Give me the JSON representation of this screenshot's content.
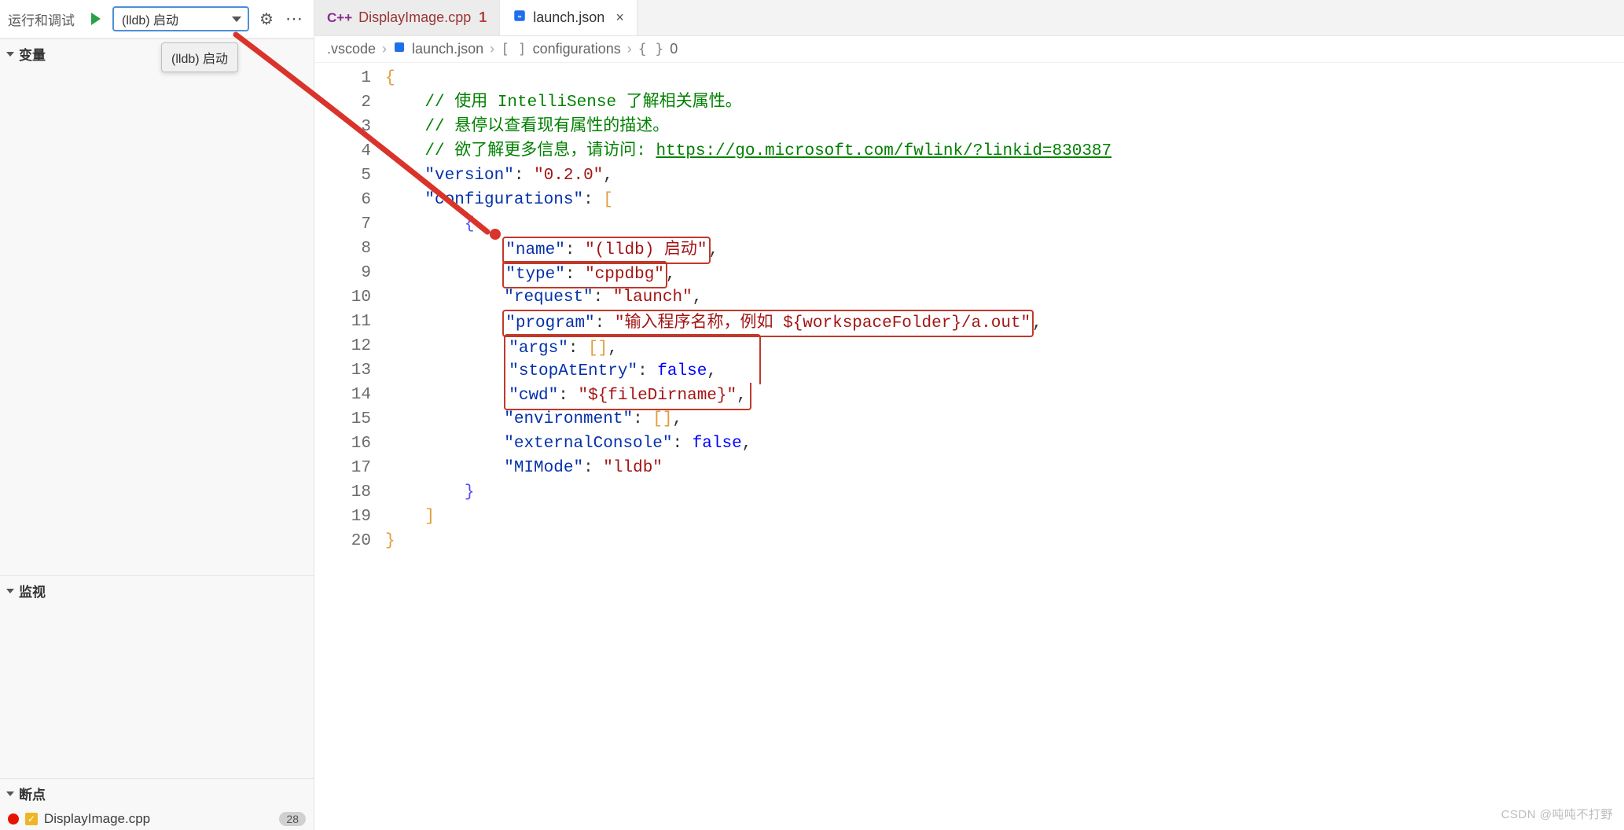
{
  "sidebar": {
    "title": "运行和调试",
    "config_selected": "(lldb) 启动",
    "tooltip": "(lldb) 启动",
    "sections": {
      "variables": "变量",
      "watch": "监视",
      "breakpoints": "断点"
    },
    "breakpoint": {
      "file": "DisplayImage.cpp",
      "count": "28"
    }
  },
  "tabs": [
    {
      "icon": "C++",
      "label": "DisplayImage.cpp",
      "dirty": "1",
      "active": false
    },
    {
      "icon": "⚙",
      "label": "launch.json",
      "close": "×",
      "active": true
    }
  ],
  "breadcrumbs": {
    "folder": ".vscode",
    "file": "launch.json",
    "path1": "configurations",
    "path2": "0"
  },
  "gutter": [
    "1",
    "2",
    "3",
    "4",
    "5",
    "6",
    "7",
    "8",
    "9",
    "10",
    "11",
    "12",
    "13",
    "14",
    "15",
    "16",
    "17",
    "18",
    "19",
    "20"
  ],
  "code": {
    "comment1": "// 使用 IntelliSense 了解相关属性。",
    "comment2": "// 悬停以查看现有属性的描述。",
    "comment3a": "// 欲了解更多信息，请访问: ",
    "comment3b": "https://go.microsoft.com/fwlink/?linkid=830387",
    "k_version": "\"version\"",
    "v_version": "\"0.2.0\"",
    "k_configs": "\"configurations\"",
    "k_name": "\"name\"",
    "v_name": "\"(lldb) 启动\"",
    "k_type": "\"type\"",
    "v_type": "\"cppdbg\"",
    "k_request": "\"request\"",
    "v_request": "\"launch\"",
    "k_program": "\"program\"",
    "v_program": "\"输入程序名称，例如 ${workspaceFolder}/a.out\"",
    "k_args": "\"args\"",
    "k_stop": "\"stopAtEntry\"",
    "v_stop": "false",
    "k_cwd": "\"cwd\"",
    "v_cwd": "\"${fileDirname}\"",
    "k_env": "\"environment\"",
    "k_ext": "\"externalConsole\"",
    "v_ext": "false",
    "k_mi": "\"MIMode\"",
    "v_mi": "\"lldb\""
  },
  "watermark": "CSDN @吨吨不打野"
}
